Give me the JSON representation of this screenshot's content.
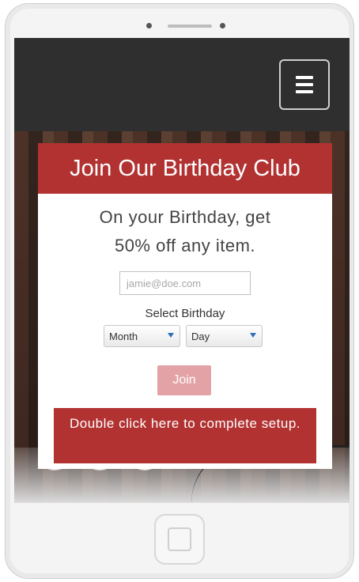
{
  "popup": {
    "title": "Join Our Birthday Club",
    "offer_line1": "On your Birthday, get",
    "offer_line2": "50% off any item.",
    "email_placeholder": "jamie@doe.com",
    "select_label": "Select Birthday",
    "month_value": "Month",
    "day_value": "Day",
    "join_label": "Join",
    "setup_text": "Double click here to complete setup."
  },
  "icons": {
    "menu": "hamburger-menu-icon",
    "social": [
      "facebook-icon",
      "pinterest-icon",
      "instagram-icon"
    ],
    "home": "home-button"
  },
  "colors": {
    "brand_red": "#b23232",
    "join_disabled": "#e3a3a6",
    "nav_bg": "#2f2f2f"
  }
}
